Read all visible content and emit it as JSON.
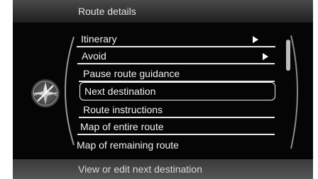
{
  "header": {
    "title": "Route details"
  },
  "menu": {
    "items": [
      {
        "label": "Itinerary",
        "has_submenu": true
      },
      {
        "label": "Avoid",
        "has_submenu": true
      },
      {
        "label": "Pause route guidance",
        "has_submenu": false
      },
      {
        "label": "Next destination",
        "has_submenu": false,
        "selected": true
      },
      {
        "label": "Route instructions",
        "has_submenu": false
      },
      {
        "label": "Map of entire route",
        "has_submenu": false
      },
      {
        "label": "Map of remaining route",
        "has_submenu": false
      }
    ]
  },
  "footer": {
    "help_text": "View or edit next destination"
  },
  "compass": {
    "letters": [
      "W",
      "E"
    ],
    "icon": "compass-icon"
  }
}
